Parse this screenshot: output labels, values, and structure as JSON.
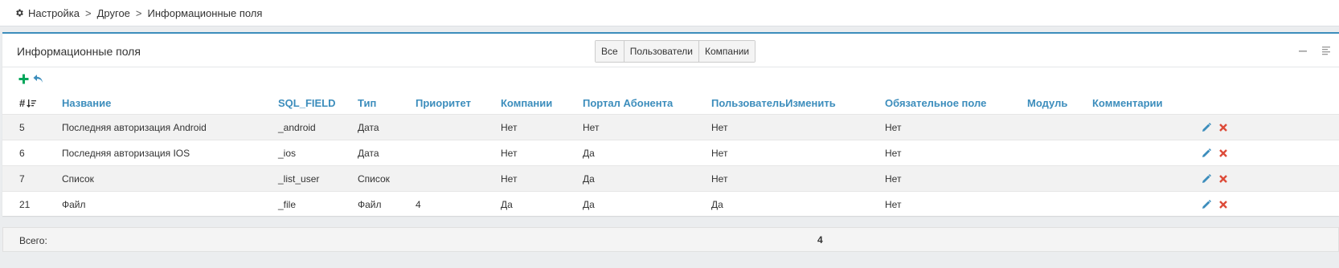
{
  "breadcrumb": {
    "items": [
      "Настройка",
      "Другое",
      "Информационные поля"
    ],
    "separator": ">"
  },
  "panel": {
    "title": "Информационные поля",
    "filters": [
      "Все",
      "Пользователи",
      "Компании"
    ]
  },
  "table": {
    "columns": [
      "#",
      "Название",
      "SQL_FIELD",
      "Тип",
      "Приоритет",
      "Компании",
      "Портал Абонента",
      "ПользовательИзменить",
      "Обязательное поле",
      "Модуль",
      "Комментарии"
    ],
    "rows": [
      [
        "5",
        "Последняя авторизация Android",
        "_android",
        "Дата",
        "",
        "Нет",
        "Нет",
        "Нет",
        "Нет",
        "",
        ""
      ],
      [
        "6",
        "Последняя авторизация IOS",
        "_ios",
        "Дата",
        "",
        "Нет",
        "Да",
        "Нет",
        "Нет",
        "",
        ""
      ],
      [
        "7",
        "Список",
        "_list_user",
        "Список",
        "",
        "Нет",
        "Да",
        "Нет",
        "Нет",
        "",
        ""
      ],
      [
        "21",
        "Файл",
        "_file",
        "Файл",
        "4",
        "Да",
        "Да",
        "Да",
        "Нет",
        "",
        ""
      ]
    ]
  },
  "footer": {
    "label": "Всего:",
    "total": "4"
  },
  "colors": {
    "accent": "#3c8dbc",
    "add": "#00a65a",
    "delete": "#dd4b39"
  }
}
